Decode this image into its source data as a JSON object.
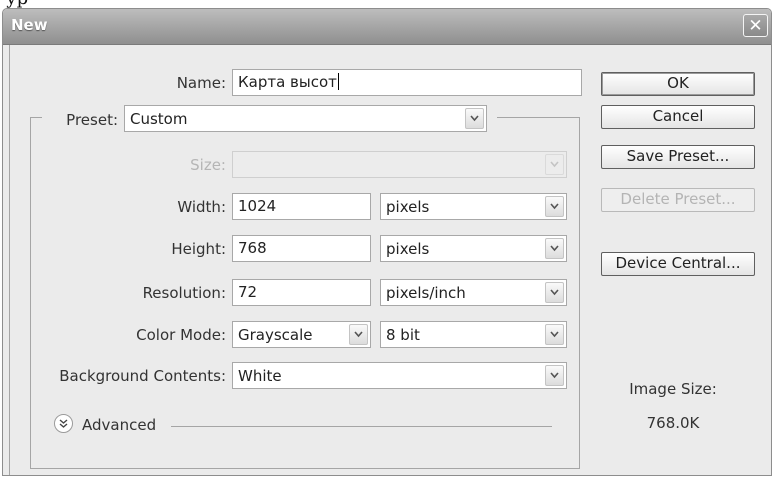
{
  "top_fragment": "ур",
  "window": {
    "title": "New",
    "close_glyph": "✕"
  },
  "form": {
    "name": {
      "label": "Name:",
      "value": "Карта высот"
    },
    "preset": {
      "label": "Preset:",
      "value": "Custom"
    },
    "size": {
      "label": "Size:",
      "value": ""
    },
    "width": {
      "label": "Width:",
      "value": "1024",
      "unit": "pixels"
    },
    "height": {
      "label": "Height:",
      "value": "768",
      "unit": "pixels"
    },
    "resolution": {
      "label": "Resolution:",
      "value": "72",
      "unit": "pixels/inch"
    },
    "color_mode": {
      "label": "Color Mode:",
      "value": "Grayscale",
      "depth": "8 bit"
    },
    "background": {
      "label": "Background Contents:",
      "value": "White"
    },
    "advanced": {
      "label": "Advanced"
    }
  },
  "buttons": {
    "ok": "OK",
    "cancel": "Cancel",
    "save_preset": "Save Preset...",
    "delete_preset": "Delete Preset...",
    "device_central": "Device Central..."
  },
  "image_size": {
    "label": "Image Size:",
    "value": "768.0K"
  },
  "colors": {
    "titlebar": "#9e9e9e",
    "dialog_bg": "#ebebeb",
    "disabled_text": "#b5b5b5"
  },
  "icons": {
    "dropdown": "chevron-down-icon",
    "advanced": "double-chevron-down-icon",
    "close": "close-icon"
  }
}
